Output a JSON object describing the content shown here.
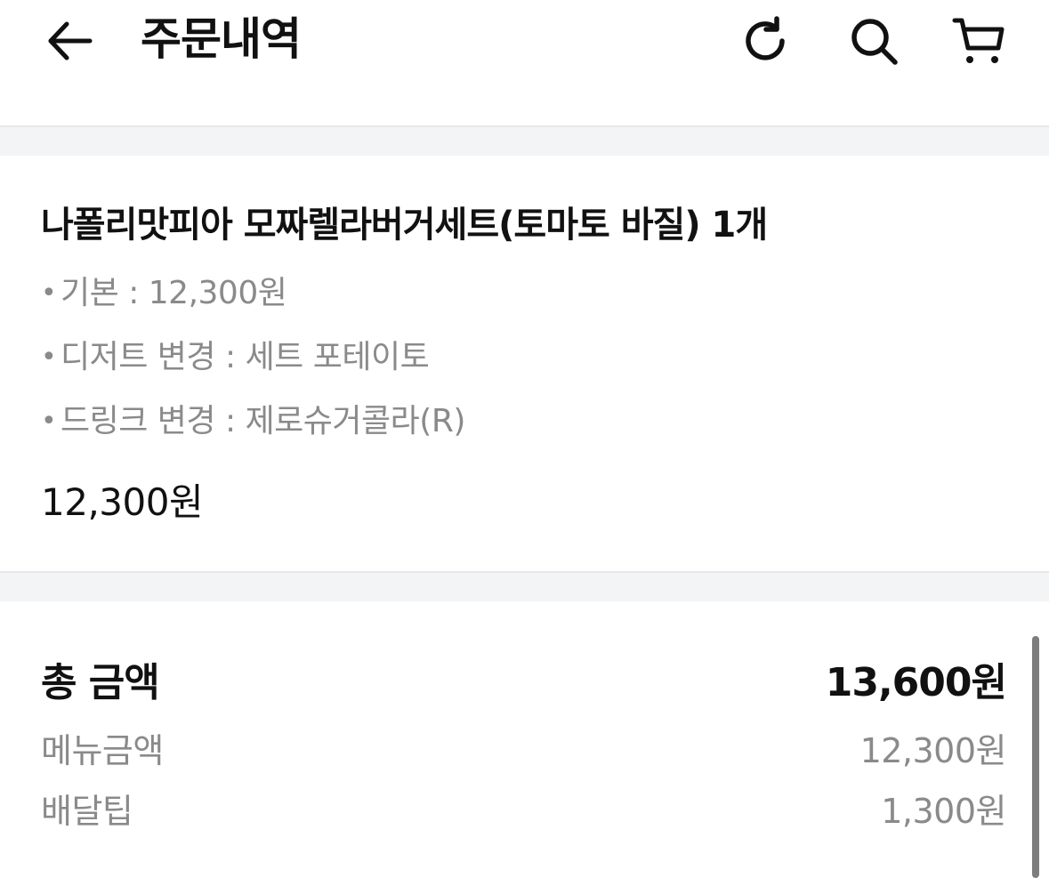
{
  "header": {
    "title": "주문내역",
    "icons": [
      "back-arrow-icon",
      "refresh-icon",
      "search-icon",
      "cart-icon"
    ]
  },
  "order": {
    "item_name": "나폴리맛피아 모짜렐라버거세트(토마토 바질) 1개",
    "options": [
      {
        "label": "기본",
        "value": "12,300원"
      },
      {
        "label": "디저트 변경",
        "value": "세트 포테이토"
      },
      {
        "label": "드링크 변경",
        "value": "제로슈거콜라(R)"
      }
    ],
    "bullet": "•",
    "separator": " : ",
    "price": "12,300원"
  },
  "summary": {
    "total_label": "총 금액",
    "total_value": "13,600원",
    "menu_label": "메뉴금액",
    "menu_value": "12,300원",
    "delivery_label": "배달팁",
    "delivery_value": "1,300원"
  },
  "colors": {
    "text_primary": "#111111",
    "text_secondary": "#8a8a8a",
    "separator_bg": "#f3f4f6"
  }
}
